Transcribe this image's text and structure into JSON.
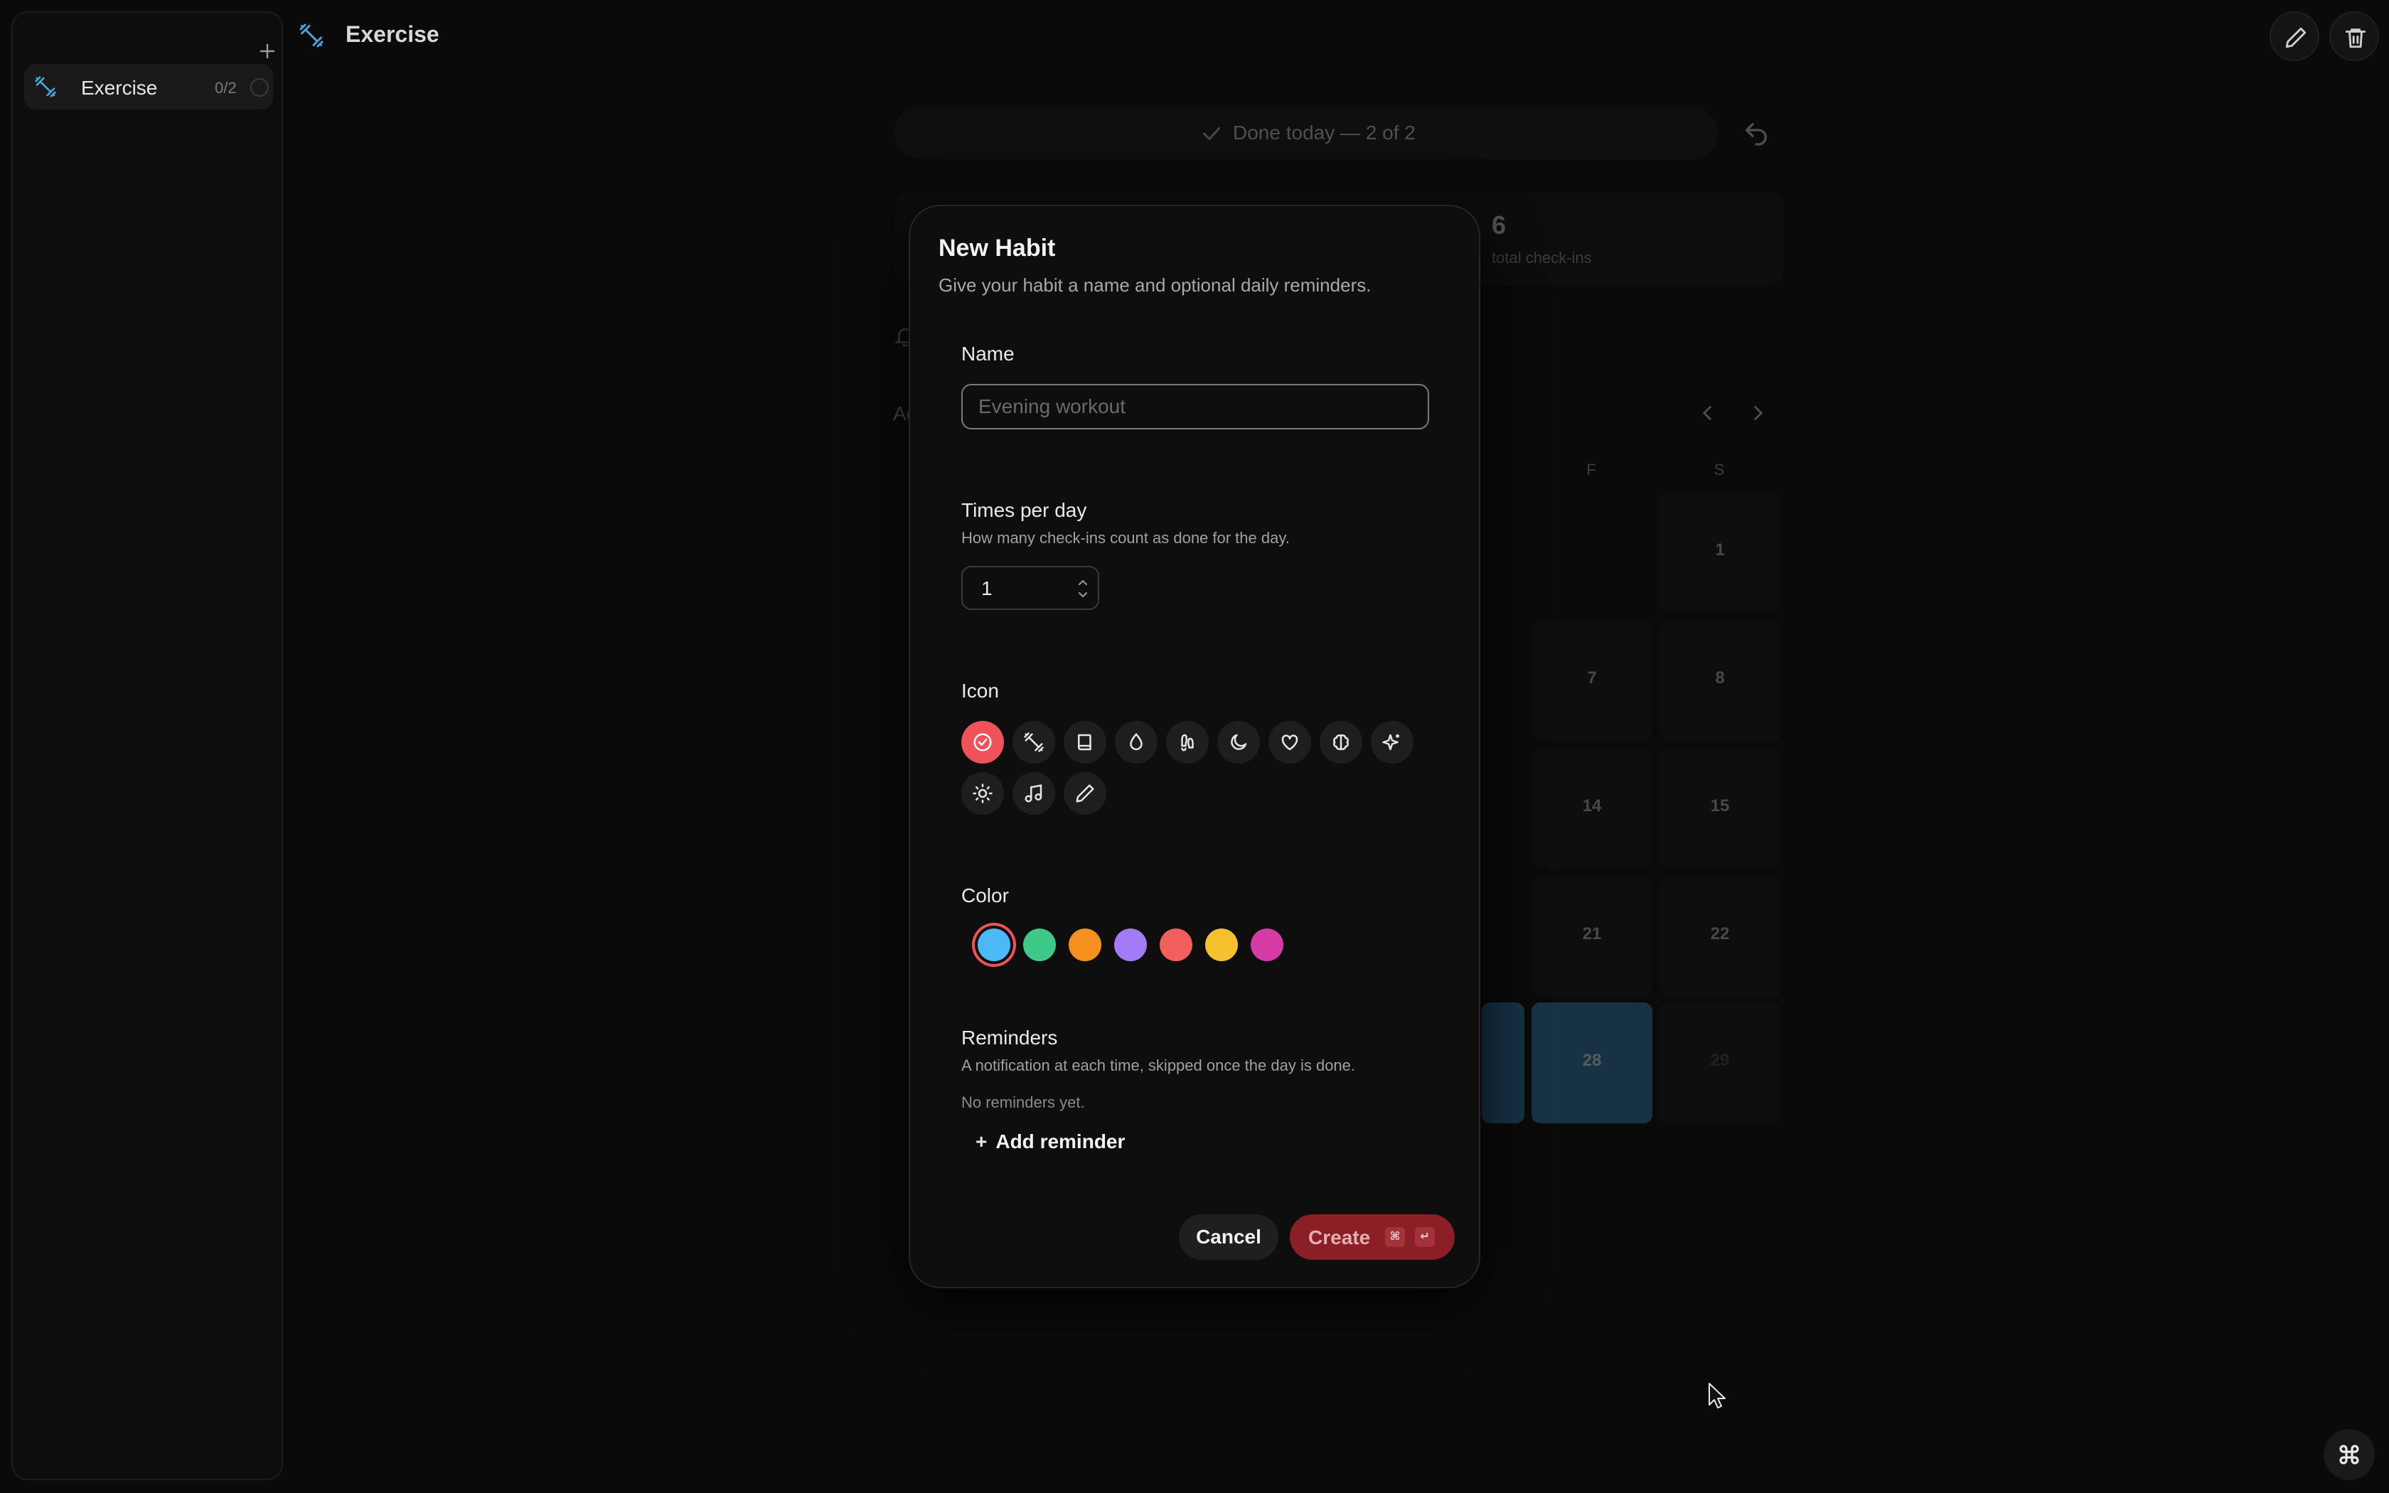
{
  "sidebar": {
    "items": [
      {
        "label": "Exercise",
        "count": "0/2",
        "icon": "dumbbell-icon"
      }
    ]
  },
  "header": {
    "title": "Exercise"
  },
  "background": {
    "done_text": "Done today — 2 of 2",
    "stats": {
      "value": "6",
      "label": "total check-ins"
    },
    "partial_label": "Ac",
    "weekdays": [
      "F",
      "S"
    ],
    "calendar_cells": [
      "1",
      "7",
      "8",
      "14",
      "15",
      "21",
      "22",
      "28",
      "29"
    ]
  },
  "dialog": {
    "title": "New Habit",
    "description": "Give your habit a name and optional daily reminders.",
    "name": {
      "label": "Name",
      "placeholder": "Evening workout",
      "value": ""
    },
    "times": {
      "label": "Times per day",
      "help": "How many check-ins count as done for the day.",
      "value": "1"
    },
    "icon": {
      "label": "Icon",
      "options": [
        "check-circle-icon",
        "dumbbell-icon",
        "book-icon",
        "droplet-icon",
        "footprints-icon",
        "moon-icon",
        "heart-icon",
        "brain-icon",
        "sparkles-icon",
        "sun-icon",
        "music-icon",
        "pencil-icon"
      ],
      "selected": "check-circle-icon"
    },
    "color": {
      "label": "Color",
      "options": [
        "#4cb8f5",
        "#3ec98a",
        "#f5901e",
        "#a37bf7",
        "#f25f5c",
        "#f7c02d",
        "#d63aa5"
      ],
      "selected": "#4cb8f5"
    },
    "reminders": {
      "label": "Reminders",
      "help": "A notification at each time, skipped once the day is done.",
      "empty": "No reminders yet.",
      "add_label": "Add reminder"
    },
    "cancel_label": "Cancel",
    "create_label": "Create",
    "shortcut": [
      "⌘",
      "↵"
    ]
  },
  "colors": {
    "accent": "#f0525a",
    "create_bg": "#8a1f26",
    "habit_blue": "#2e7fb3"
  }
}
